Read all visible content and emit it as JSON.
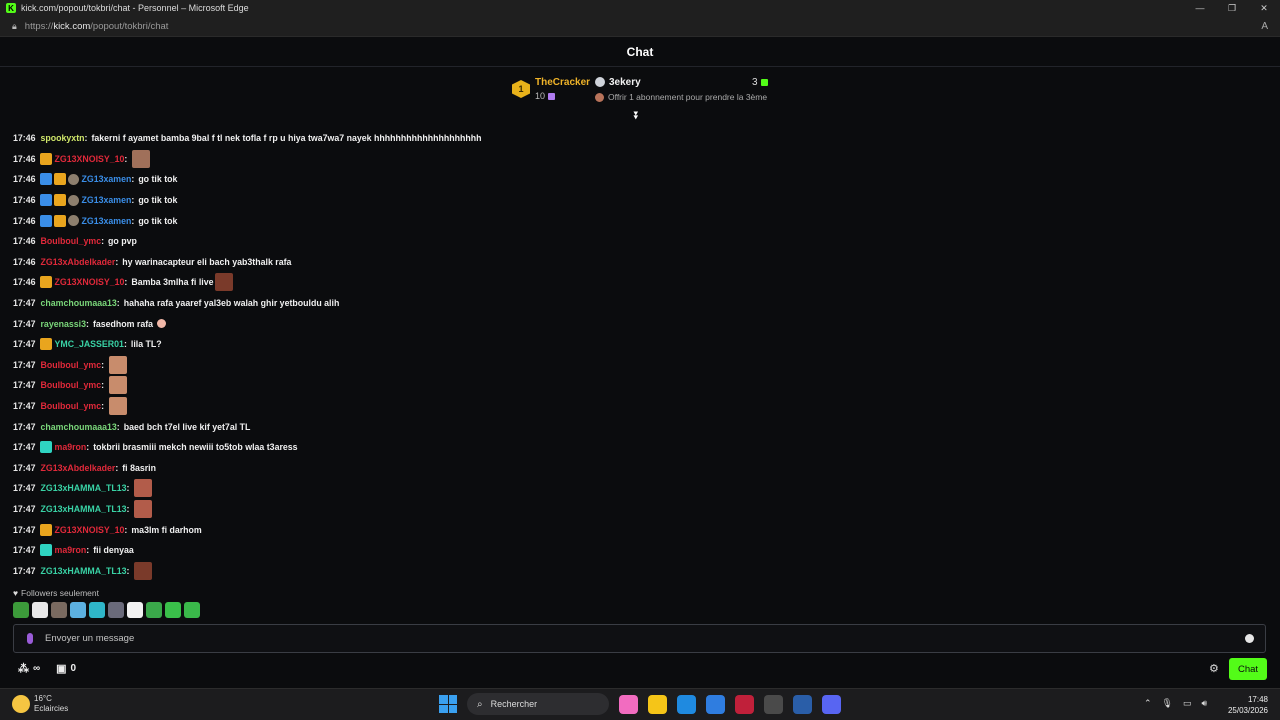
{
  "window": {
    "title": "kick.com/popout/tokbri/chat - Personnel – Microsoft Edge",
    "url_prefix": "https://",
    "url_host": "kick.com",
    "url_path": "/popout/tokbri/chat"
  },
  "chat_header": {
    "title": "Chat"
  },
  "leaderboard": {
    "rank1": {
      "rank": "1",
      "name": "TheCracker",
      "count": "10"
    },
    "rank2": {
      "name": "3ekery",
      "count": "3"
    },
    "rank3": {
      "text": "Offrir 1 abonnement pour prendre la 3ème"
    }
  },
  "colors": {
    "kick_green": "#53fc18",
    "red_user": "#e0293a",
    "green_user": "#7ad67a",
    "blue_user": "#3a8ee8",
    "teal_user": "#39d2a5",
    "gold": "#f0b429"
  },
  "messages": [
    {
      "time": "17:46",
      "user": "spookyxtn",
      "color": "#cfe66a",
      "badges": [],
      "text": "fakerni f ayamet bamba 9bal f tl nek tofla f rp u hiya twa7wa7 nayek hhhhhhhhhhhhhhhhhhhh",
      "emote": ""
    },
    {
      "time": "17:46",
      "user": "ZG13XNOISY_10",
      "color": "#e0293a",
      "badges": [
        "crown"
      ],
      "text": "",
      "emote": "e1"
    },
    {
      "time": "17:46",
      "user": "ZG13xamen",
      "color": "#3a8ee8",
      "badges": [
        "og",
        "crown",
        "face"
      ],
      "text": "go tik tok",
      "emote": ""
    },
    {
      "time": "17:46",
      "user": "ZG13xamen",
      "color": "#3a8ee8",
      "badges": [
        "og",
        "crown",
        "face"
      ],
      "text": "go tik tok",
      "emote": ""
    },
    {
      "time": "17:46",
      "user": "ZG13xamen",
      "color": "#3a8ee8",
      "badges": [
        "og",
        "crown",
        "face"
      ],
      "text": "go tik tok",
      "emote": ""
    },
    {
      "time": "17:46",
      "user": "Boulboul_ymc",
      "color": "#e0293a",
      "badges": [],
      "text": "go pvp",
      "emote": ""
    },
    {
      "time": "17:46",
      "user": "ZG13xAbdelkader",
      "color": "#e0293a",
      "badges": [],
      "text": "hy warinacapteur eli bach yab3thalk rafa",
      "emote": ""
    },
    {
      "time": "17:46",
      "user": "ZG13XNOISY_10",
      "color": "#e0293a",
      "badges": [
        "crown"
      ],
      "text": "Bamba 3mlha fi live",
      "emote": "e3"
    },
    {
      "time": "17:47",
      "user": "chamchoumaaa13",
      "color": "#7ad67a",
      "badges": [],
      "text": "hahaha rafa yaaref yal3eb walah ghir yetbouldu alih",
      "emote": ""
    },
    {
      "time": "17:47",
      "user": "rayenassi3",
      "color": "#7ad67a",
      "badges": [],
      "text": "fasedhom rafa",
      "emote": "smile"
    },
    {
      "time": "17:47",
      "user": "YMC_JASSER01",
      "color": "#39d2a5",
      "badges": [
        "crown"
      ],
      "text": "lila TL?",
      "emote": ""
    },
    {
      "time": "17:47",
      "user": "Boulboul_ymc",
      "color": "#e0293a",
      "badges": [],
      "text": "",
      "emote": "e2"
    },
    {
      "time": "17:47",
      "user": "Boulboul_ymc",
      "color": "#e0293a",
      "badges": [],
      "text": "",
      "emote": "e2"
    },
    {
      "time": "17:47",
      "user": "Boulboul_ymc",
      "color": "#e0293a",
      "badges": [],
      "text": "",
      "emote": "e2"
    },
    {
      "time": "17:47",
      "user": "chamchoumaaa13",
      "color": "#7ad67a",
      "badges": [],
      "text": "baed bch t7el live kif yet7al TL",
      "emote": ""
    },
    {
      "time": "17:47",
      "user": "ma9ron",
      "color": "#e0293a",
      "badges": [
        "sub"
      ],
      "text": "tokbrii brasmiii mekch newiii to5tob wlaa t3aress",
      "emote": ""
    },
    {
      "time": "17:47",
      "user": "ZG13xAbdelkader",
      "color": "#e0293a",
      "badges": [],
      "text": "fi 8asrin",
      "emote": ""
    },
    {
      "time": "17:47",
      "user": "ZG13xHAMMA_TL13",
      "color": "#39d2a5",
      "badges": [],
      "text": "",
      "emote": "e4"
    },
    {
      "time": "17:47",
      "user": "ZG13xHAMMA_TL13",
      "color": "#39d2a5",
      "badges": [],
      "text": "",
      "emote": "e4"
    },
    {
      "time": "17:47",
      "user": "ZG13XNOISY_10",
      "color": "#e0293a",
      "badges": [
        "crown"
      ],
      "text": "ma3lm fi darhom",
      "emote": ""
    },
    {
      "time": "17:47",
      "user": "ma9ron",
      "color": "#e0293a",
      "badges": [
        "sub"
      ],
      "text": "fii denyaa",
      "emote": ""
    },
    {
      "time": "17:47",
      "user": "ZG13xHAMMA_TL13",
      "color": "#39d2a5",
      "badges": [],
      "text": "",
      "emote": "e3"
    }
  ],
  "followers_only": "Followers seulement",
  "emote_bar": [
    "#3c9b3a",
    "#e8e8e8",
    "#7a6a60",
    "#5cb0e0",
    "#2fb6c8",
    "#6a6a7a",
    "#f2f2f2",
    "#3aa84a",
    "#3ac04a",
    "#3ab84a"
  ],
  "input": {
    "placeholder": "Envoyer un message"
  },
  "toolbar": {
    "infinity": "∞",
    "count": "0",
    "chat_button": "Chat"
  },
  "taskbar": {
    "temperature": "16°C",
    "condition": "Eclaircies",
    "search_label": "Rechercher",
    "time": "17:48",
    "date": "25/03/2026",
    "apps": [
      "#f26cc0",
      "#f5c518",
      "#1f8ae0",
      "#2f7de0",
      "#c0203a",
      "#4a4a4a",
      "#2a5ea8",
      "#5865f2"
    ]
  }
}
